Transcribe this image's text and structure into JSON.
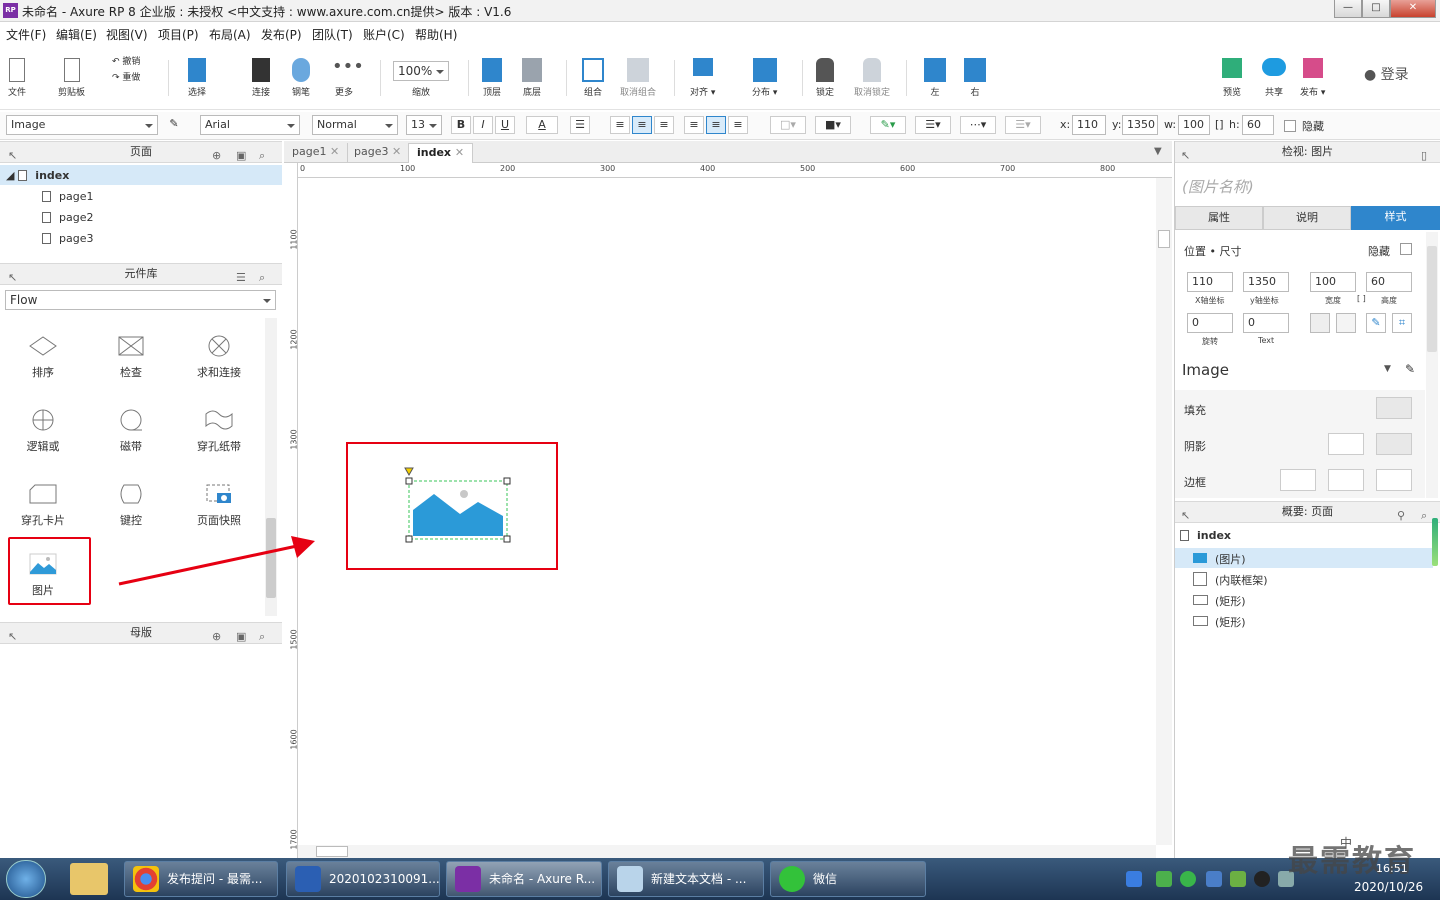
{
  "window": {
    "title": "未命名 - Axure RP 8 企业版 : 未授权      <中文支持 : www.axure.com.cn提供> 版本 : V1.6",
    "rp_badge": "RP",
    "btn_min": "—",
    "btn_max": "□",
    "btn_close": "✕"
  },
  "menu": [
    "文件(F)",
    "编辑(E)",
    "视图(V)",
    "项目(P)",
    "布局(A)",
    "发布(P)",
    "团队(T)",
    "账户(C)",
    "帮助(H)"
  ],
  "toolbar": {
    "file": "文件",
    "clipboard": "剪贴板",
    "undo": "撤销",
    "redo": "重做",
    "select": "选择",
    "connect": "连接",
    "pen": "钢笔",
    "more": "更多",
    "zoom": "100%",
    "zoom_label": "缩放",
    "top": "顶层",
    "bottom": "底层",
    "group": "组合",
    "ungroup": "取消组合",
    "align": "对齐",
    "distribute": "分布",
    "lock": "锁定",
    "unlock": "取消锁定",
    "left": "左",
    "right": "右",
    "preview": "预览",
    "share": "共享",
    "publish": "发布",
    "login": "登录"
  },
  "format": {
    "widget_type": "Image",
    "font": "Arial",
    "style": "Normal",
    "size": "13",
    "bold": "B",
    "italic": "I",
    "underline": "U",
    "text_color": "A",
    "x_label": "x:",
    "x": "110",
    "y_label": "y:",
    "y": "1350",
    "w_label": "w:",
    "w": "100",
    "h_label": "h:",
    "h": "60",
    "hide": "隐藏"
  },
  "pages_panel": {
    "title": "页面",
    "pages": [
      "index",
      "page1",
      "page2",
      "page3"
    ]
  },
  "library_panel": {
    "title": "元件库",
    "library": "Flow",
    "widgets": [
      "排序",
      "检查",
      "求和连接",
      "逻辑或",
      "磁带",
      "穿孔纸带",
      "穿孔卡片",
      "键控",
      "页面快照",
      "图片"
    ]
  },
  "masters_panel": {
    "title": "母版"
  },
  "tabs": [
    "page1",
    "page3",
    "index"
  ],
  "ruler": {
    "h": [
      "0",
      "100",
      "200",
      "300",
      "400",
      "500",
      "600",
      "700",
      "800"
    ],
    "v": [
      "1100",
      "1200",
      "1300",
      "1500",
      "1600",
      "1700"
    ]
  },
  "inspector": {
    "title": "检视: 图片",
    "name_placeholder": "(图片名称)",
    "tabs": [
      "属性",
      "说明",
      "样式"
    ],
    "section_pos": "位置 • 尺寸",
    "hide": "隐藏",
    "x": "110",
    "x_lbl": "X轴坐标",
    "y": "1350",
    "y_lbl": "y轴坐标",
    "w": "100",
    "w_lbl": "宽度",
    "h": "60",
    "h_lbl": "高度",
    "rot": "0",
    "rot_lbl": "旋转",
    "text_rot": "0",
    "text_lbl": "Text",
    "style": "Image",
    "fill": "填充",
    "shadow": "阴影",
    "border": "边框"
  },
  "outline": {
    "title": "概要: 页面",
    "root": "index",
    "items": [
      "(图片)",
      "(内联框架)",
      "(矩形)",
      "(矩形)"
    ]
  },
  "taskbar": {
    "items": [
      "发布提问 - 最需...",
      "2020102310091...",
      "未命名 - Axure R...",
      "新建文本文档 - ...",
      "微信"
    ],
    "date": "2020/10/26",
    "time": "16:51",
    "watermark": "最需教育",
    "lang": "中"
  },
  "colors": {
    "accent": "#2f86cc",
    "highlight": "#e60012"
  }
}
